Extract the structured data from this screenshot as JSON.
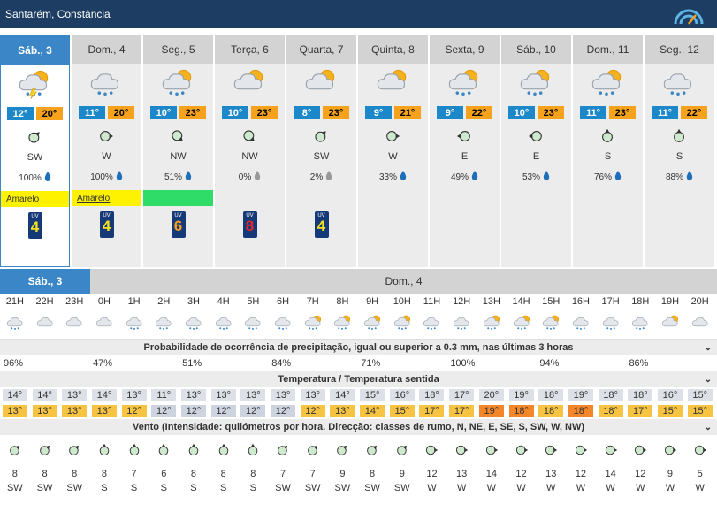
{
  "header": {
    "title": "Santarém, Constância"
  },
  "days": [
    {
      "label": "Sáb., 3",
      "icon": "thunder-rain",
      "tmin": "12°",
      "tmax": "20°",
      "wind": "SW",
      "precip": "100%",
      "warning": "Amarelo",
      "warn_color": "yellow",
      "uv": "4",
      "uv_color": "#f6e21c"
    },
    {
      "label": "Dom., 4",
      "icon": "cloud-rain",
      "tmin": "11°",
      "tmax": "20°",
      "wind": "W",
      "precip": "100%",
      "warning": "Amarelo",
      "warn_color": "yellow",
      "uv": "4",
      "uv_color": "#f6e21c"
    },
    {
      "label": "Seg., 5",
      "icon": "sun-cloud-rain",
      "tmin": "10°",
      "tmax": "23°",
      "wind": "NW",
      "precip": "51%",
      "warning": "",
      "warn_color": "green",
      "uv": "6",
      "uv_color": "#f6a21c"
    },
    {
      "label": "Terça, 6",
      "icon": "sun-cloud",
      "tmin": "10°",
      "tmax": "23°",
      "wind": "NW",
      "precip": "0%",
      "warning": "",
      "warn_color": "",
      "uv": "8",
      "uv_color": "#e8262a"
    },
    {
      "label": "Quarta, 7",
      "icon": "sun-cloud",
      "tmin": "8°",
      "tmax": "23°",
      "wind": "SW",
      "precip": "2%",
      "warning": "",
      "warn_color": "",
      "uv": "4",
      "uv_color": "#f6e21c"
    },
    {
      "label": "Quinta, 8",
      "icon": "sun-cloud",
      "tmin": "9°",
      "tmax": "21°",
      "wind": "W",
      "precip": "33%",
      "warning": "",
      "warn_color": "",
      "uv": "",
      "uv_color": ""
    },
    {
      "label": "Sexta, 9",
      "icon": "sun-cloud-rain",
      "tmin": "9°",
      "tmax": "22°",
      "wind": "E",
      "precip": "49%",
      "warning": "",
      "warn_color": "",
      "uv": "",
      "uv_color": ""
    },
    {
      "label": "Sáb., 10",
      "icon": "sun-cloud-rain",
      "tmin": "10°",
      "tmax": "23°",
      "wind": "E",
      "precip": "53%",
      "warning": "",
      "warn_color": "",
      "uv": "",
      "uv_color": ""
    },
    {
      "label": "Dom., 11",
      "icon": "sun-cloud-rain",
      "tmin": "11°",
      "tmax": "23°",
      "wind": "S",
      "precip": "76%",
      "warning": "",
      "warn_color": "",
      "uv": "",
      "uv_color": ""
    },
    {
      "label": "Seg., 12",
      "icon": "cloud-rain",
      "tmin": "11°",
      "tmax": "22°",
      "wind": "S",
      "precip": "88%",
      "warning": "",
      "warn_color": "",
      "uv": "",
      "uv_color": ""
    }
  ],
  "hourly": {
    "day1_label": "Sáb., 3",
    "day2_label": "Dom., 4",
    "hours": [
      "21H",
      "22H",
      "23H",
      "0H",
      "1H",
      "2H",
      "3H",
      "4H",
      "5H",
      "6H",
      "7H",
      "8H",
      "9H",
      "10H",
      "11H",
      "12H",
      "13H",
      "14H",
      "15H",
      "16H",
      "17H",
      "18H",
      "19H",
      "20H"
    ],
    "icons": [
      "cloud-rain",
      "moon-cloud",
      "moon-cloud",
      "moon-cloud",
      "moon-rain",
      "moon-rain",
      "cloud-rain",
      "cloud-rain",
      "cloud-rain",
      "cloud-rain",
      "sun-cloud-rain",
      "sun-cloud-rain",
      "sun-cloud-rain",
      "sun-cloud-rain",
      "cloud-rain",
      "cloud-rain",
      "sun-cloud-rain",
      "sun-cloud-rain",
      "sun-cloud-rain",
      "cloud-rain",
      "cloud-rain",
      "cloud-rain",
      "sun-cloud",
      "moon-cloud"
    ],
    "precip_title": "Probabilidade de ocorrência de precipitação, igual ou superior a 0.3 mm, nas últimas 3 horas",
    "precip": [
      "96%",
      "",
      "",
      "47%",
      "",
      "",
      "51%",
      "",
      "",
      "84%",
      "",
      "",
      "71%",
      "",
      "",
      "100%",
      "",
      "",
      "94%",
      "",
      "",
      "86%",
      "",
      ""
    ],
    "temp_title": "Temperatura / Temperatura sentida",
    "temp": [
      "14°",
      "14°",
      "13°",
      "14°",
      "13°",
      "11°",
      "13°",
      "13°",
      "13°",
      "13°",
      "13°",
      "14°",
      "15°",
      "16°",
      "18°",
      "17°",
      "20°",
      "19°",
      "18°",
      "19°",
      "18°",
      "18°",
      "16°",
      "15°"
    ],
    "feels": [
      "13°",
      "13°",
      "13°",
      "13°",
      "12°",
      "12°",
      "12°",
      "12°",
      "12°",
      "12°",
      "12°",
      "13°",
      "14°",
      "15°",
      "17°",
      "17°",
      "19°",
      "18°",
      "18°",
      "18°",
      "18°",
      "17°",
      "15°",
      "15°"
    ],
    "feels_colors": [
      "#f6c343",
      "#f6c343",
      "#f6c343",
      "#f6c343",
      "#f6c343",
      "#cdd4e0",
      "#cdd4e0",
      "#cdd4e0",
      "#cdd4e0",
      "#cdd4e0",
      "#f6c343",
      "#f6c343",
      "#f6c343",
      "#f6c343",
      "#f6c343",
      "#f6c343",
      "#f4862a",
      "#f4862a",
      "#f6c343",
      "#f4862a",
      "#f6c343",
      "#f6c343",
      "#f6c343",
      "#f6c343"
    ],
    "wind_title": "Vento (Intensidade: quilómetros por hora. Direcção: classes de rumo, N, NE, E, SE, S, SW, W, NW)",
    "wind_speed": [
      "8",
      "8",
      "8",
      "8",
      "7",
      "6",
      "8",
      "8",
      "8",
      "7",
      "7",
      "9",
      "8",
      "9",
      "12",
      "13",
      "14",
      "12",
      "13",
      "12",
      "14",
      "12",
      "9",
      "5"
    ],
    "wind_dir": [
      "SW",
      "SW",
      "SW",
      "S",
      "S",
      "S",
      "S",
      "S",
      "S",
      "SW",
      "SW",
      "SW",
      "SW",
      "SW",
      "W",
      "W",
      "W",
      "W",
      "W",
      "W",
      "W",
      "W",
      "W",
      "W"
    ]
  }
}
